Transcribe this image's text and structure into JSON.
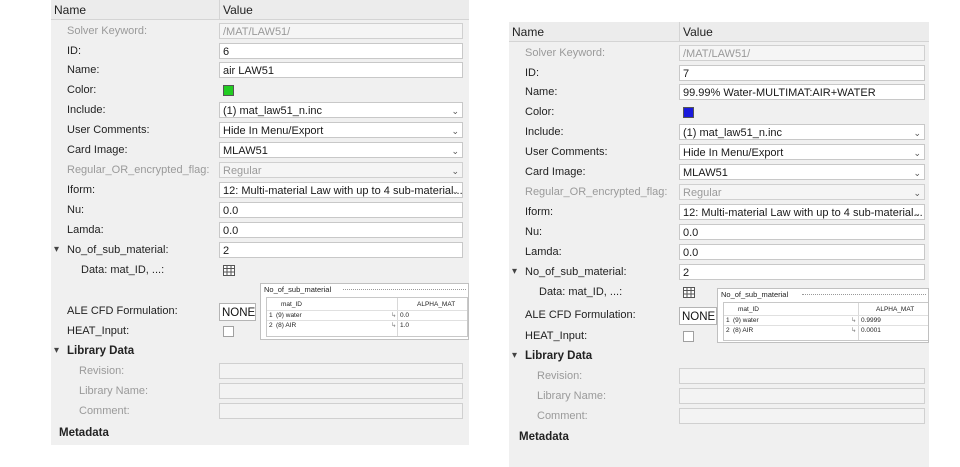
{
  "panels": [
    {
      "header": {
        "name": "Name",
        "value": "Value"
      },
      "rows": {
        "solver_keyword": {
          "label": "Solver Keyword:",
          "value": "/MAT/LAW51/"
        },
        "id": {
          "label": "ID:",
          "value": "6"
        },
        "name": {
          "label": "Name:",
          "value": "air LAW51"
        },
        "color": {
          "label": "Color:",
          "value": "#22cc22"
        },
        "include": {
          "label": "Include:",
          "value": "(1) mat_law51_n.inc"
        },
        "user_comments": {
          "label": "User Comments:",
          "value": "Hide In Menu/Export"
        },
        "card_image": {
          "label": "Card Image:",
          "value": "MLAW51"
        },
        "regular_flag": {
          "label": "Regular_OR_encrypted_flag:",
          "value": "Regular"
        },
        "iform": {
          "label": "Iform:",
          "value": "12: Multi-material Law with up to 4 sub-material..."
        },
        "nu": {
          "label": "Nu:",
          "value": "0.0"
        },
        "lamda": {
          "label": "Lamda:",
          "value": "0.0"
        },
        "no_of_sub_material": {
          "label": "No_of_sub_material:",
          "value": "2"
        },
        "data": {
          "label": "Data: mat_ID, ...:"
        },
        "ale_cfd": {
          "label": "ALE CFD Formulation:",
          "value": "NONE"
        },
        "heat_input": {
          "label": "HEAT_Input:"
        },
        "library_data": {
          "label": "Library Data"
        },
        "revision": {
          "label": "Revision:"
        },
        "library_name": {
          "label": "Library Name:"
        },
        "comment": {
          "label": "Comment:"
        },
        "metadata": {
          "label": "Metadata"
        }
      },
      "popup": {
        "title": "No_of_sub_material",
        "columns": [
          "mat_ID",
          "ALPHA_MAT"
        ],
        "rows": [
          {
            "idx": "1",
            "mat": "(9) water",
            "alpha": "0.0"
          },
          {
            "idx": "2",
            "mat": "(8) AIR",
            "alpha": "1.0"
          }
        ]
      }
    },
    {
      "header": {
        "name": "Name",
        "value": "Value"
      },
      "rows": {
        "solver_keyword": {
          "label": "Solver Keyword:",
          "value": "/MAT/LAW51/"
        },
        "id": {
          "label": "ID:",
          "value": "7"
        },
        "name": {
          "label": "Name:",
          "value": "99.99% Water-MULTIMAT:AIR+WATER"
        },
        "color": {
          "label": "Color:",
          "value": "#1a1adc"
        },
        "include": {
          "label": "Include:",
          "value": "(1) mat_law51_n.inc"
        },
        "user_comments": {
          "label": "User Comments:",
          "value": "Hide In Menu/Export"
        },
        "card_image": {
          "label": "Card Image:",
          "value": "MLAW51"
        },
        "regular_flag": {
          "label": "Regular_OR_encrypted_flag:",
          "value": "Regular"
        },
        "iform": {
          "label": "Iform:",
          "value": "12: Multi-material Law with up to 4 sub-material..."
        },
        "nu": {
          "label": "Nu:",
          "value": "0.0"
        },
        "lamda": {
          "label": "Lamda:",
          "value": "0.0"
        },
        "no_of_sub_material": {
          "label": "No_of_sub_material:",
          "value": "2"
        },
        "data": {
          "label": "Data: mat_ID, ...:"
        },
        "ale_cfd": {
          "label": "ALE CFD Formulation:",
          "value": "NONE"
        },
        "heat_input": {
          "label": "HEAT_Input:"
        },
        "library_data": {
          "label": "Library Data"
        },
        "revision": {
          "label": "Revision:"
        },
        "library_name": {
          "label": "Library Name:"
        },
        "comment": {
          "label": "Comment:"
        },
        "metadata": {
          "label": "Metadata"
        }
      },
      "popup": {
        "title": "No_of_sub_material",
        "columns": [
          "mat_ID",
          "ALPHA_MAT"
        ],
        "rows": [
          {
            "idx": "1",
            "mat": "(9) water",
            "alpha": "0.9999"
          },
          {
            "idx": "2",
            "mat": "(8) AIR",
            "alpha": "0.0001"
          }
        ]
      }
    }
  ]
}
